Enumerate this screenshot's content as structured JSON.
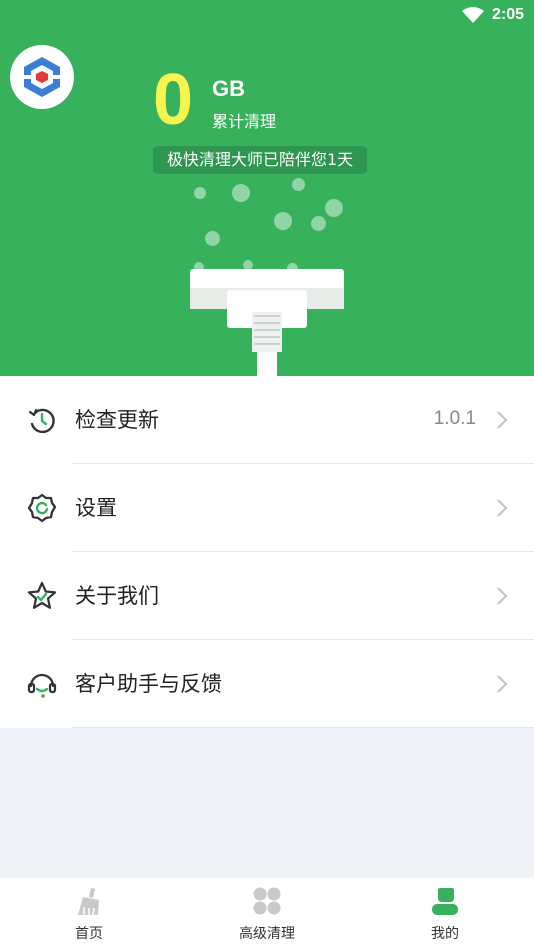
{
  "status_bar": {
    "time": "2:05"
  },
  "header": {
    "total_cleaned_value": "0",
    "total_cleaned_unit": "GB",
    "total_cleaned_caption": "累计清理",
    "companion_text": "极快清理大师已陪伴您1天",
    "bg_color": "#37b15c",
    "number_color": "#f7f44f"
  },
  "menu": {
    "items": [
      {
        "label": "检查更新",
        "value": "1.0.1",
        "icon": "refresh-clock-icon"
      },
      {
        "label": "设置",
        "value": "",
        "icon": "gear-icon"
      },
      {
        "label": "关于我们",
        "value": "",
        "icon": "star-icon"
      },
      {
        "label": "客户助手与反馈",
        "value": "",
        "icon": "headset-icon"
      }
    ]
  },
  "bottom_nav": {
    "items": [
      {
        "label": "首页",
        "icon": "broom-icon",
        "active": false
      },
      {
        "label": "高级清理",
        "icon": "grid-icon",
        "active": false
      },
      {
        "label": "我的",
        "icon": "user-icon",
        "active": true
      }
    ],
    "active_color": "#37b15c"
  }
}
